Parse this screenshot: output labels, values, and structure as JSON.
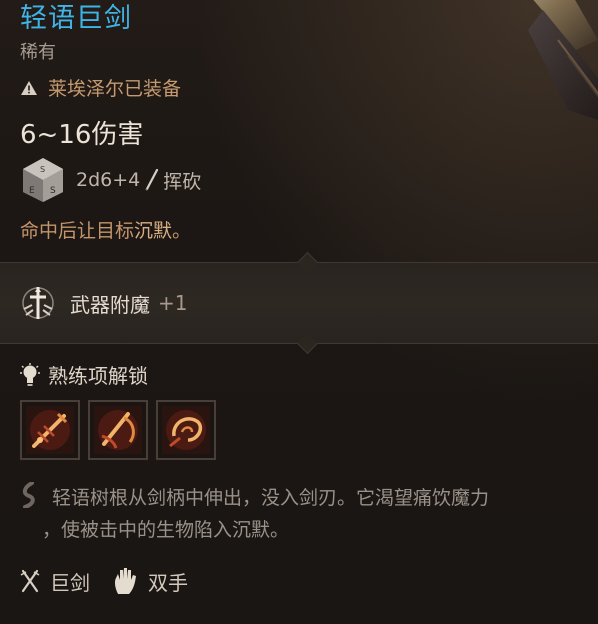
{
  "item": {
    "name": "轻语巨剑",
    "rarity": "稀有",
    "equipped_by": "莱埃泽尔已装备",
    "damage": "6~16伤害",
    "dice": {
      "formula": "2d6+4",
      "damage_type": "挥砍"
    },
    "effect": {
      "prefix": "命中后让目标",
      "highlight": "沉默",
      "suffix": "。"
    }
  },
  "enchant": {
    "label": "武器附魔",
    "bonus": "+1"
  },
  "proficiency": {
    "label": "熟练项解锁",
    "abilities": [
      {
        "icon": "sword-strike-icon"
      },
      {
        "icon": "cleave-icon"
      },
      {
        "icon": "whirl-slash-icon"
      }
    ]
  },
  "lore": {
    "line1": "轻语树根从剑柄中伸出，没入剑刃。它渴望痛饮魔力",
    "line2": "，使被击中的生物陷入沉默。"
  },
  "properties": {
    "type": "巨剑",
    "hands": "双手"
  },
  "colors": {
    "title": "#3fb4e6",
    "equipped": "#c59a6f",
    "effect": "#c4956a"
  }
}
